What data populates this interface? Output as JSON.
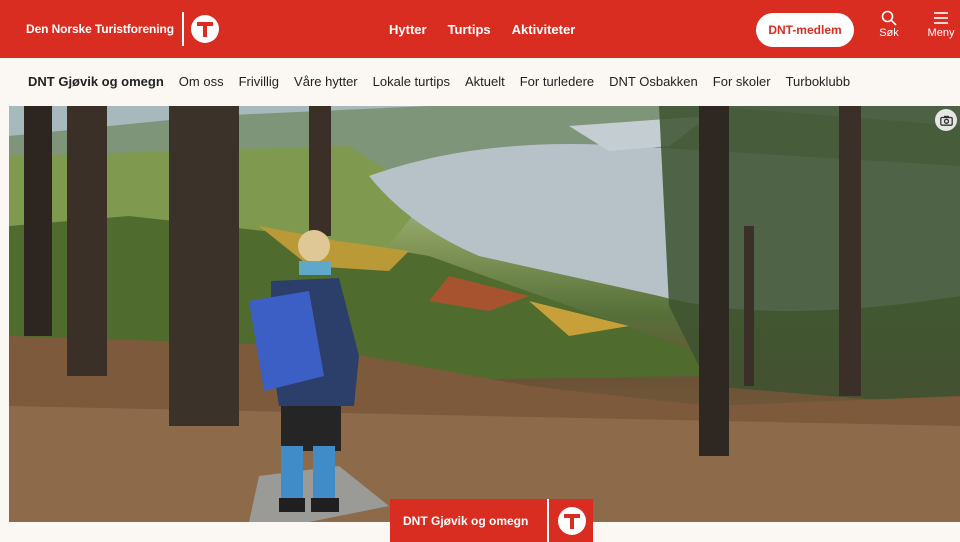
{
  "header": {
    "brand_name": "Den Norske Turistforening",
    "nav": [
      "Hytter",
      "Turtips",
      "Aktiviteter"
    ],
    "member_button": "DNT-medlem",
    "search_label": "Søk",
    "menu_label": "Meny"
  },
  "subnav": {
    "items": [
      "DNT Gjøvik og omegn",
      "Om oss",
      "Frivillig",
      "Våre hytter",
      "Lokale turtips",
      "Aktuelt",
      "For turledere",
      "DNT Osbakken",
      "For skoler",
      "Turboklubb"
    ]
  },
  "hero": {
    "badge_name": "DNT Gjøvik og omegn"
  },
  "colors": {
    "brand_red": "#d82d20",
    "page_bg": "#fbf8f3"
  },
  "icons": [
    "dnt-logo-icon",
    "search-icon",
    "menu-icon",
    "camera-icon"
  ]
}
